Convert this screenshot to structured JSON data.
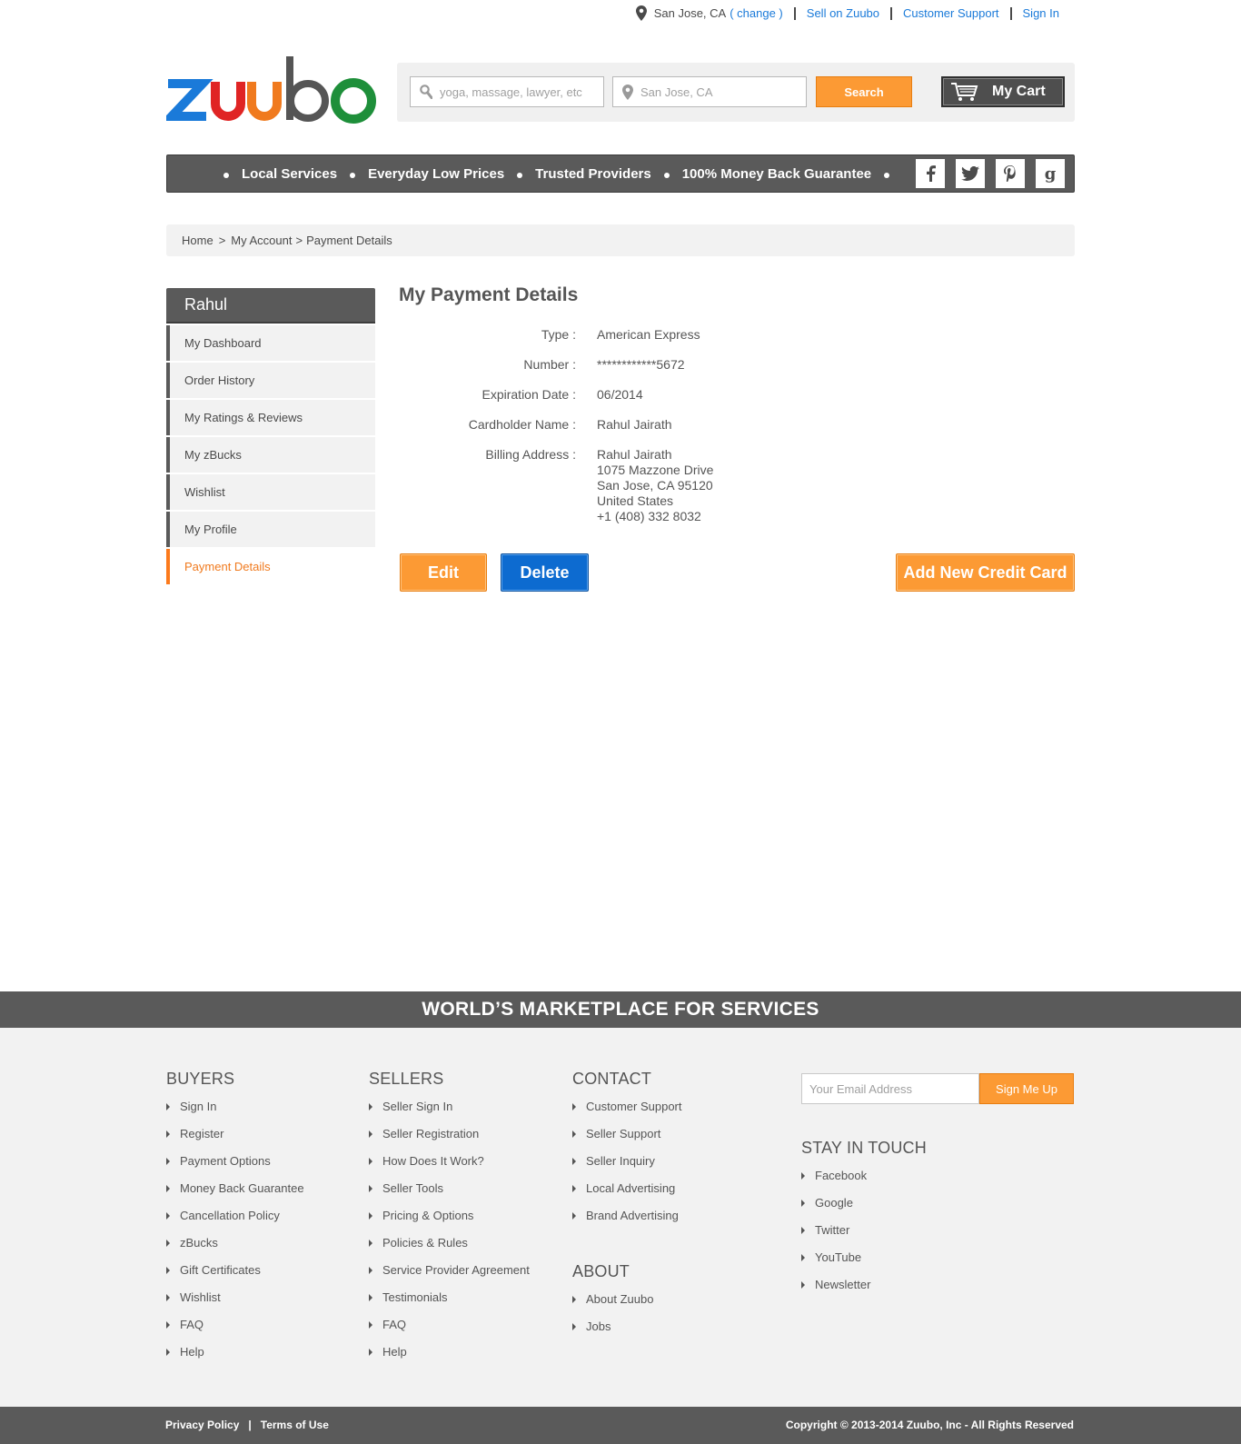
{
  "topbar": {
    "location": "San Jose, CA",
    "change": "( change )",
    "sell": "Sell on Zuubo",
    "support": "Customer Support",
    "signin": "Sign In"
  },
  "brand": {
    "logo_text": "zuubo",
    "colors": {
      "blue": "#1a7ad9",
      "red": "#e02424",
      "orange": "#f07a1e",
      "gray": "#555555",
      "green": "#1e8f3a",
      "accent": "#fc9a34"
    }
  },
  "search": {
    "query_placeholder": "yoga, massage, lawyer, etc",
    "location_placeholder": "San Jose, CA",
    "button": "Search",
    "cart": "My Cart"
  },
  "nav": {
    "features": [
      "Local Services",
      "Everyday Low Prices",
      "Trusted Providers",
      "100% Money Back Guarantee"
    ],
    "social": [
      {
        "icon": "facebook-icon",
        "glyph": "f"
      },
      {
        "icon": "twitter-icon",
        "glyph": ""
      },
      {
        "icon": "pinterest-icon",
        "glyph": "P"
      },
      {
        "icon": "google-icon",
        "glyph": "g"
      }
    ]
  },
  "breadcrumb": {
    "home": "Home",
    "sep1": ">",
    "account": "My Account",
    "sep2": ">",
    "current": "Payment Details"
  },
  "sidebar": {
    "user": "Rahul",
    "items": [
      {
        "label": "My Dashboard"
      },
      {
        "label": "Order History"
      },
      {
        "label": "My Ratings & Reviews"
      },
      {
        "label": "My zBucks"
      },
      {
        "label": "Wishlist"
      },
      {
        "label": "My Profile"
      },
      {
        "label": "Payment Details"
      }
    ]
  },
  "payment": {
    "title": "My Payment Details",
    "type_label": "Type :",
    "type": "American Express",
    "number_label": "Number :",
    "number": "************5672",
    "exp_label": "Expiration Date :",
    "exp": "06/2014",
    "holder_label": "Cardholder Name :",
    "holder": "Rahul Jairath",
    "address_label": "Billing Address :",
    "address": [
      "Rahul Jairath",
      "1075 Mazzone Drive",
      "San Jose, CA 95120",
      "United States",
      "+1 (408) 332 8032"
    ],
    "edit": "Edit",
    "delete": "Delete",
    "add": "Add New Credit Card"
  },
  "footer": {
    "band": "WORLD’S MARKETPLACE FOR SERVICES",
    "buyers": {
      "title": "BUYERS",
      "items": [
        "Sign In",
        "Register",
        "Payment Options",
        "Money Back Guarantee",
        "Cancellation Policy",
        "zBucks",
        "Gift Certificates",
        "Wishlist",
        "FAQ",
        "Help"
      ]
    },
    "sellers": {
      "title": "SELLERS",
      "items": [
        "Seller Sign In",
        "Seller Registration",
        "How Does It Work?",
        "Seller Tools",
        "Pricing & Options",
        "Policies & Rules",
        "Service Provider Agreement",
        "Testimonials",
        "FAQ",
        "Help"
      ]
    },
    "contact": {
      "title": "CONTACT",
      "items": [
        "Customer Support",
        "Seller Support",
        "Seller Inquiry",
        "Local Advertising",
        "Brand Advertising"
      ]
    },
    "about": {
      "title": "ABOUT",
      "items": [
        "About Zuubo",
        "Jobs"
      ]
    },
    "subscribe": {
      "placeholder": "Your Email Address",
      "button": "Sign Me Up"
    },
    "stay": {
      "title": "STAY IN TOUCH",
      "items": [
        "Facebook",
        "Google",
        "Twitter",
        "YouTube",
        "Newsletter"
      ]
    },
    "bottom": {
      "privacy": "Privacy Policy",
      "sep": "|",
      "terms": "Terms of Use",
      "copyright": "Copyright © 2013-2014 Zuubo, Inc - All Rights Reserved"
    }
  }
}
